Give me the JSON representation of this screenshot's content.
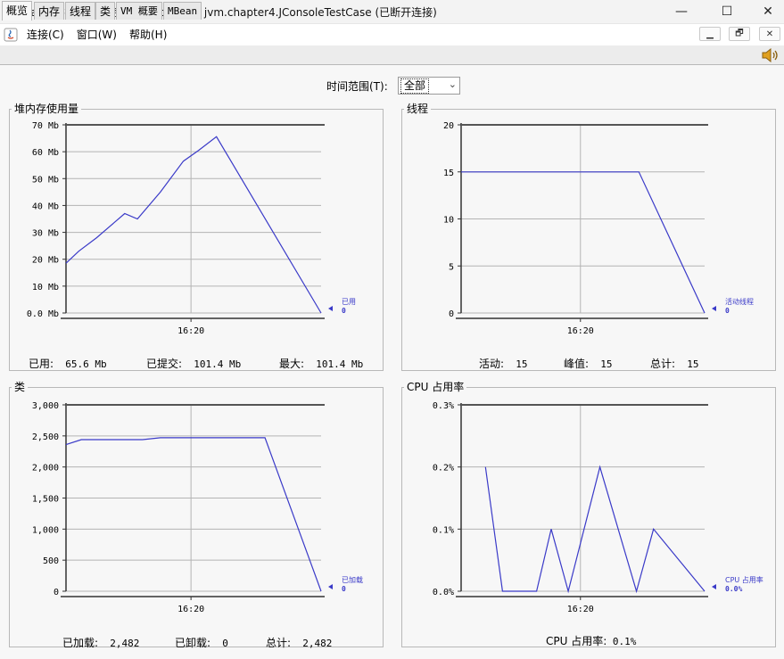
{
  "window": {
    "title": "Java 监视和管理控制台 - pid: 1056 jvm.chapter4.JConsoleTestCase (已断开连接)",
    "minimize": "—",
    "maximize": "☐",
    "close": "✕"
  },
  "menu": {
    "items": [
      "连接(C)",
      "窗口(W)",
      "帮助(H)"
    ],
    "inner_minimize": "▁",
    "inner_restore": "🗗",
    "inner_close": "✕"
  },
  "tabs": [
    {
      "label": "概览",
      "active": true
    },
    {
      "label": "内存",
      "active": false
    },
    {
      "label": "线程",
      "active": false
    },
    {
      "label": "类",
      "active": false
    },
    {
      "label": "VM 概要",
      "active": false
    },
    {
      "label": "MBean",
      "active": false
    }
  ],
  "time_range": {
    "label": "时间范围(T):",
    "value": "全部"
  },
  "colors": {
    "series": "#3a3ac8",
    "grid": "#b4b4b4",
    "axis": "#333333"
  },
  "panels": {
    "heap": {
      "title": "堆内存使用量",
      "legend_name": "已用",
      "legend_value": "0",
      "stats": [
        {
          "label": "已用:",
          "value": "65.6  Mb"
        },
        {
          "label": "已提交:",
          "value": "101.4  Mb"
        },
        {
          "label": "最大:",
          "value": "101.4  Mb"
        }
      ]
    },
    "threads": {
      "title": "线程",
      "legend_name": "活动线程",
      "legend_value": "0",
      "stats": [
        {
          "label": "活动:",
          "value": "15"
        },
        {
          "label": "峰值:",
          "value": "15"
        },
        {
          "label": "总计:",
          "value": "15"
        }
      ]
    },
    "classes": {
      "title": "类",
      "legend_name": "已加载",
      "legend_value": "0",
      "stats": [
        {
          "label": "已加载:",
          "value": "2,482"
        },
        {
          "label": "已卸载:",
          "value": "0"
        },
        {
          "label": "总计:",
          "value": "2,482"
        }
      ]
    },
    "cpu": {
      "title": "CPU 占用率",
      "legend_name": "CPU 占用率",
      "legend_value": "0.0%",
      "stats": [
        {
          "label": "CPU 占用率:",
          "value": "0.1%"
        }
      ]
    }
  },
  "chart_data": [
    {
      "type": "line",
      "title": "堆内存使用量",
      "ylim": [
        0,
        70
      ],
      "yticks": [
        0,
        10,
        20,
        30,
        40,
        50,
        60,
        70
      ],
      "ytick_labels": [
        "0.0 Mb",
        "10 Mb",
        "20 Mb",
        "30 Mb",
        "40 Mb",
        "50 Mb",
        "60 Mb",
        "70 Mb"
      ],
      "xlim": [
        0,
        100
      ],
      "xticks": [
        49
      ],
      "xtick_labels": [
        "16:20"
      ],
      "series": [
        {
          "name": "已用",
          "x": [
            0,
            5,
            12,
            23,
            28,
            37,
            46,
            52,
            59,
            100
          ],
          "y": [
            18.5,
            23,
            28,
            37,
            35,
            45,
            56.5,
            60.5,
            65.6,
            0
          ]
        }
      ]
    },
    {
      "type": "line",
      "title": "线程",
      "ylim": [
        0,
        20
      ],
      "yticks": [
        0,
        5,
        10,
        15,
        20
      ],
      "ytick_labels": [
        "0",
        "5",
        "10",
        "15",
        "20"
      ],
      "xlim": [
        0,
        100
      ],
      "xticks": [
        49
      ],
      "xtick_labels": [
        "16:20"
      ],
      "series": [
        {
          "name": "活动线程",
          "x": [
            0,
            73,
            100
          ],
          "y": [
            15,
            15,
            0
          ]
        }
      ]
    },
    {
      "type": "line",
      "title": "类",
      "ylim": [
        0,
        3000
      ],
      "yticks": [
        0,
        500,
        1000,
        1500,
        2000,
        2500,
        3000
      ],
      "ytick_labels": [
        "0",
        "500",
        "1,000",
        "1,500",
        "2,000",
        "2,500",
        "3,000"
      ],
      "xlim": [
        0,
        100
      ],
      "xticks": [
        49
      ],
      "xtick_labels": [
        "16:20"
      ],
      "series": [
        {
          "name": "已加载",
          "x": [
            0,
            6,
            30,
            37,
            78,
            100
          ],
          "y": [
            2360,
            2440,
            2440,
            2470,
            2470,
            0
          ]
        }
      ]
    },
    {
      "type": "line",
      "title": "CPU 占用率",
      "ylim": [
        0,
        0.3
      ],
      "yticks": [
        0,
        0.1,
        0.2,
        0.3
      ],
      "ytick_labels": [
        "0.0%",
        "0.1%",
        "0.2%",
        "0.3%"
      ],
      "xlim": [
        0,
        100
      ],
      "xticks": [
        49
      ],
      "xtick_labels": [
        "16:20"
      ],
      "series": [
        {
          "name": "CPU 占用率",
          "x": [
            10,
            17,
            31,
            37,
            44,
            57,
            72,
            79,
            100
          ],
          "y": [
            0.2,
            0,
            0,
            0.1,
            0,
            0.2,
            0,
            0.1,
            0
          ]
        }
      ]
    }
  ]
}
